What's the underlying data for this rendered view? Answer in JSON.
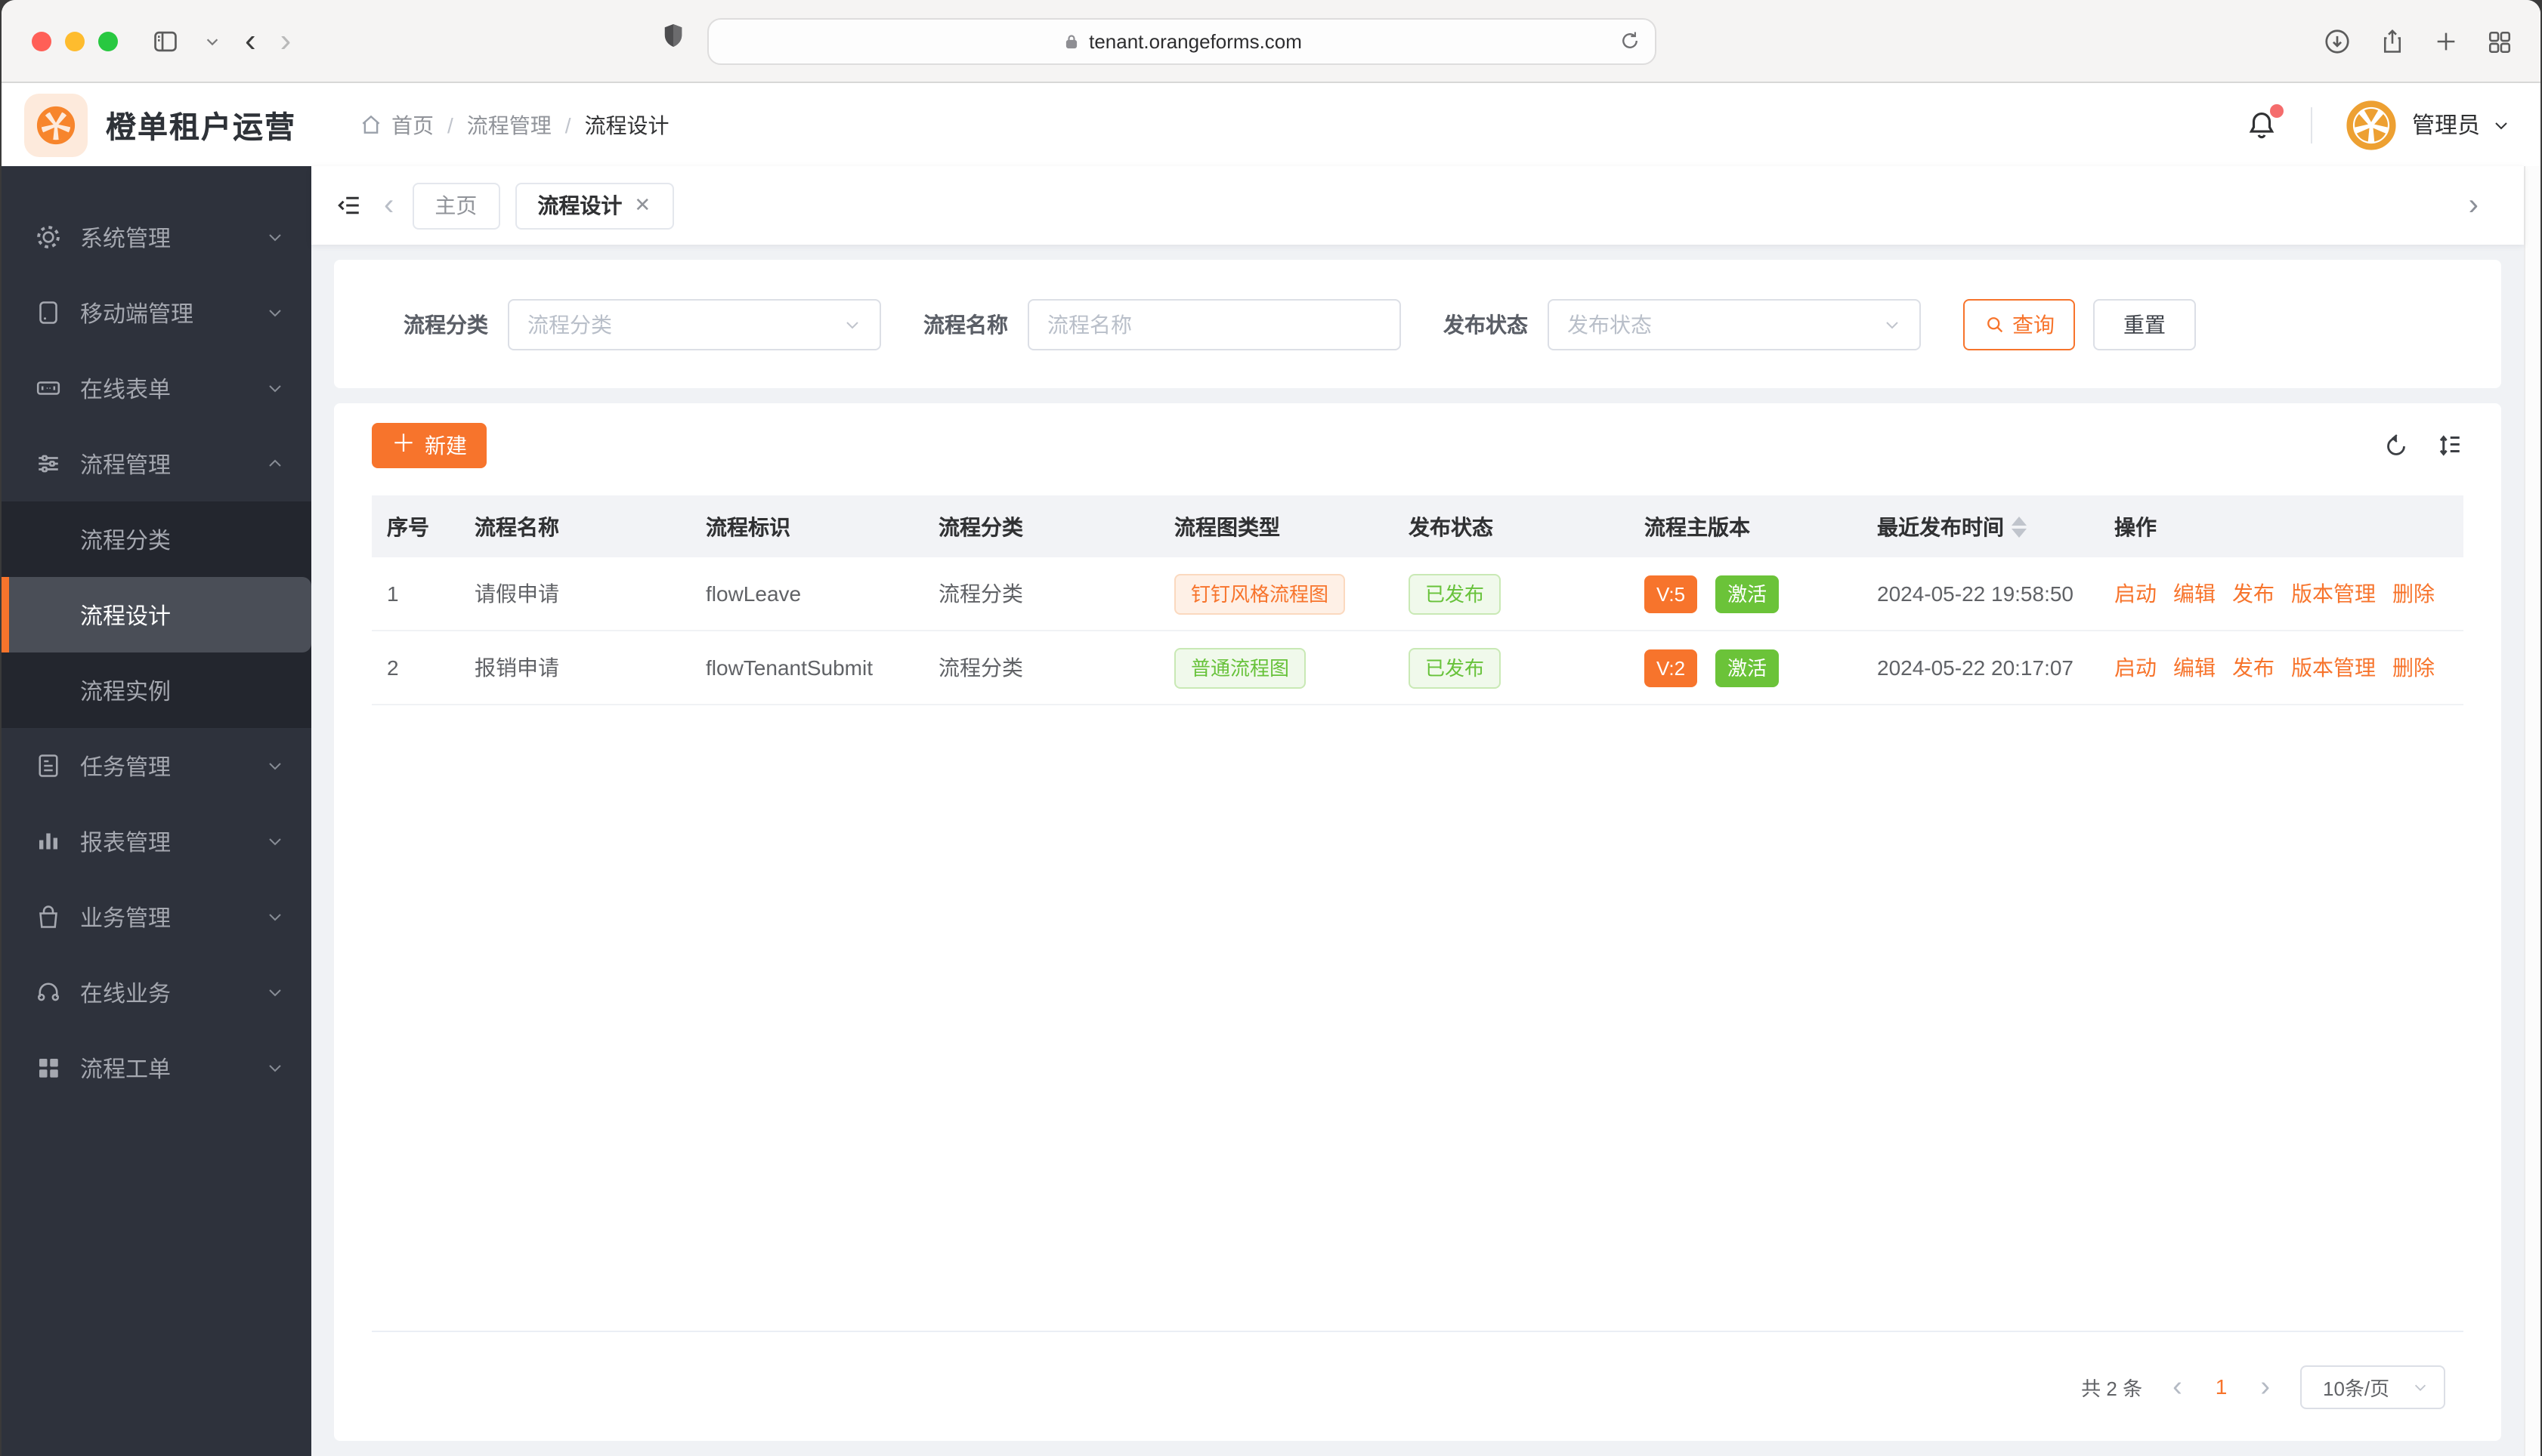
{
  "theme": {
    "accent": "#f7742c",
    "success": "#67c23a",
    "danger": "#f56c6c",
    "sidebar_bg": "#2e323c",
    "warning_tag_bg": "#fef0e6",
    "success_tag_bg": "#f0f9eb"
  },
  "browser": {
    "url": "tenant.orangeforms.com"
  },
  "header": {
    "app_title": "橙单租户运营",
    "breadcrumb": [
      "首页",
      "流程管理",
      "流程设计"
    ],
    "user_name": "管理员"
  },
  "sidebar": {
    "items": [
      {
        "label": "系统管理",
        "icon": "gear-icon"
      },
      {
        "label": "移动端管理",
        "icon": "mobile-icon"
      },
      {
        "label": "在线表单",
        "icon": "form-icon"
      },
      {
        "label": "流程管理",
        "icon": "sliders-icon",
        "expanded": true
      },
      {
        "label": "任务管理",
        "icon": "tasks-icon"
      },
      {
        "label": "报表管理",
        "icon": "bar-chart-icon"
      },
      {
        "label": "业务管理",
        "icon": "bag-icon"
      },
      {
        "label": "在线业务",
        "icon": "headset-icon"
      },
      {
        "label": "流程工单",
        "icon": "grid-icon"
      }
    ],
    "submenu": [
      {
        "label": "流程分类"
      },
      {
        "label": "流程设计",
        "active": true
      },
      {
        "label": "流程实例"
      }
    ]
  },
  "tabs": {
    "items": [
      {
        "label": "主页"
      },
      {
        "label": "流程设计",
        "closable": true,
        "active": true
      }
    ]
  },
  "filters": {
    "category_label": "流程分类",
    "category_placeholder": "流程分类",
    "name_label": "流程名称",
    "name_placeholder": "流程名称",
    "status_label": "发布状态",
    "status_placeholder": "发布状态",
    "query_label": "查询",
    "reset_label": "重置"
  },
  "toolbar": {
    "create_label": "新建"
  },
  "table": {
    "headers": [
      "序号",
      "流程名称",
      "流程标识",
      "流程分类",
      "流程图类型",
      "发布状态",
      "流程主版本",
      "最近发布时间",
      "操作"
    ],
    "rows": [
      {
        "index": "1",
        "name": "请假申请",
        "flow_key": "flowLeave",
        "category": "流程分类",
        "graph_type": {
          "label": "钉钉风格流程图",
          "variant": "warning"
        },
        "publish_status": {
          "label": "已发布",
          "variant": "success"
        },
        "main_version": "V:5",
        "active_label": "激活",
        "published_at": "2024-05-22 19:58:50",
        "actions": [
          "启动",
          "编辑",
          "发布",
          "版本管理",
          "删除"
        ]
      },
      {
        "index": "2",
        "name": "报销申请",
        "flow_key": "flowTenantSubmit",
        "category": "流程分类",
        "graph_type": {
          "label": "普通流程图",
          "variant": "success"
        },
        "publish_status": {
          "label": "已发布",
          "variant": "success"
        },
        "main_version": "V:2",
        "active_label": "激活",
        "published_at": "2024-05-22 20:17:07",
        "actions": [
          "启动",
          "编辑",
          "发布",
          "版本管理",
          "删除"
        ]
      }
    ]
  },
  "pagination": {
    "total_label": "共 2 条",
    "current_page": "1",
    "page_size_label": "10条/页"
  }
}
